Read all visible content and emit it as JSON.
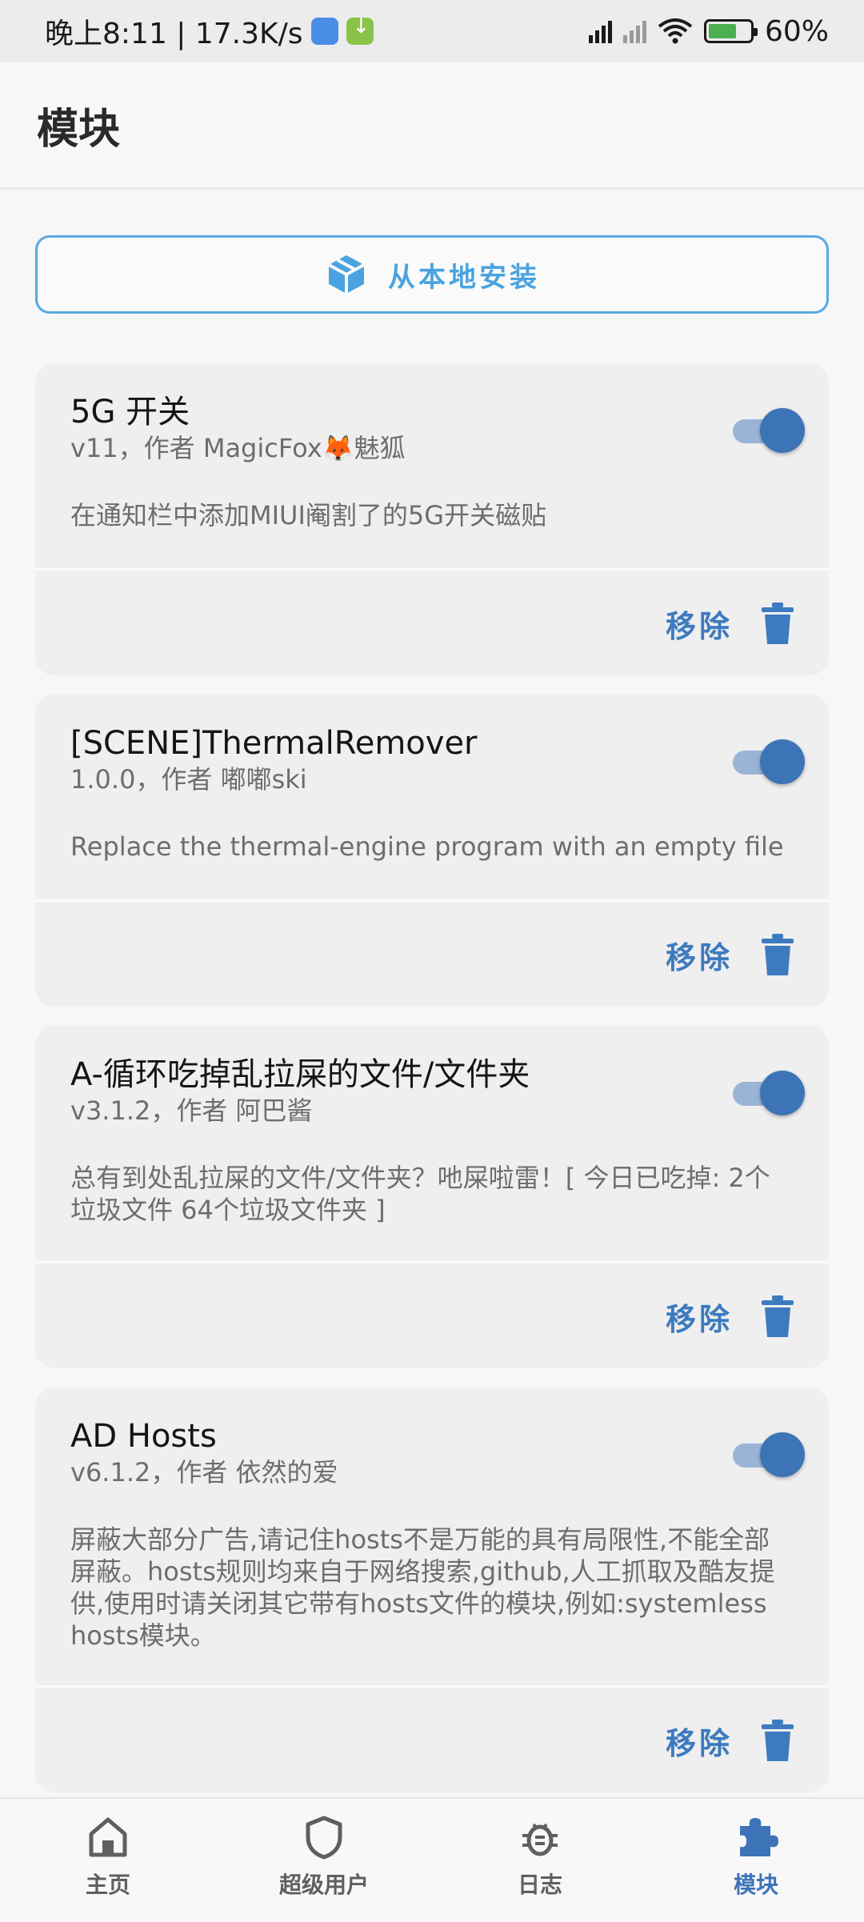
{
  "status_bar": {
    "time_speed": "晚上8:11 | 17.3K/s",
    "battery": "60%",
    "battery_level": 0.6
  },
  "header": {
    "title": "模块"
  },
  "install_button": {
    "label": "从本地安装",
    "icon": "package-icon"
  },
  "modules": [
    {
      "title": "5G 开关",
      "meta": "v11，作者 MagicFox🦊魅狐",
      "description": "在通知栏中添加MIUI阉割了的5G开关磁贴",
      "enabled": true,
      "remove_label": "移除"
    },
    {
      "title": "[SCENE]ThermalRemover",
      "meta": "1.0.0，作者 嘟嘟ski",
      "description": "Replace the thermal-engine program with an empty file",
      "enabled": true,
      "remove_label": "移除"
    },
    {
      "title": "A-循环吃掉乱拉屎的文件/文件夹",
      "meta": "v3.1.2，作者 阿巴酱",
      "description": "总有到处乱拉屎的文件/文件夹？吔屎啦雷！[ 今日已吃掉: 2个垃圾文件 64个垃圾文件夹 ]",
      "enabled": true,
      "remove_label": "移除"
    },
    {
      "title": "AD Hosts",
      "meta": "v6.1.2，作者 依然的爱",
      "description": "屏蔽大部分广告,请记住hosts不是万能的具有局限性,不能全部屏蔽。hosts规则均来自于网络搜索,github,人工抓取及酷友提供,使用时请关闭其它带有hosts文件的模块,例如:systemless hosts模块。",
      "enabled": true,
      "remove_label": "移除"
    }
  ],
  "bottom_nav": [
    {
      "label": "主页",
      "icon": "home-icon",
      "active": false
    },
    {
      "label": "超级用户",
      "icon": "shield-icon",
      "active": false
    },
    {
      "label": "日志",
      "icon": "bug-icon",
      "active": false
    },
    {
      "label": "模块",
      "icon": "puzzle-icon",
      "active": true
    }
  ],
  "colors": {
    "accent": "#3d74b8",
    "install_accent": "#4aa3df"
  }
}
